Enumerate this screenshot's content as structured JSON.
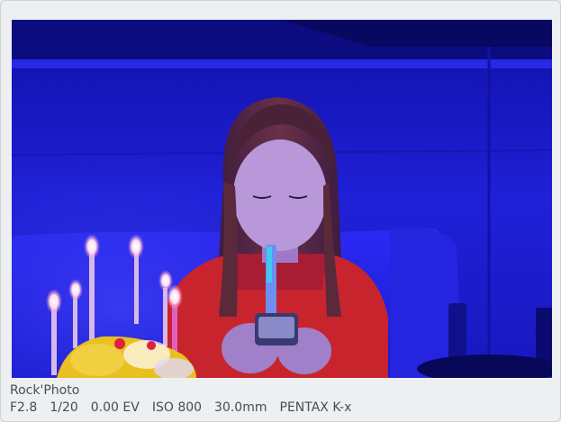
{
  "photo": {
    "subject": "photo-birthday-candles",
    "colors": {
      "wall": "#1c1cc8",
      "wall_light": "#2a2af0",
      "ceiling": "#0e0e8a",
      "sweater": "#c8242e",
      "hair": "#5a2a3a",
      "skin": "#b898d8",
      "flame": "#ffe9f0",
      "candle": "#d8b8e8",
      "cake": "#e8c020"
    }
  },
  "caption": {
    "title": "Rock'Photo",
    "exif": {
      "aperture": "F2.8",
      "shutter": "1/20",
      "ev": "0.00 EV",
      "iso": "ISO 800",
      "focal": "30.0mm",
      "camera": "PENTAX K-x"
    }
  }
}
